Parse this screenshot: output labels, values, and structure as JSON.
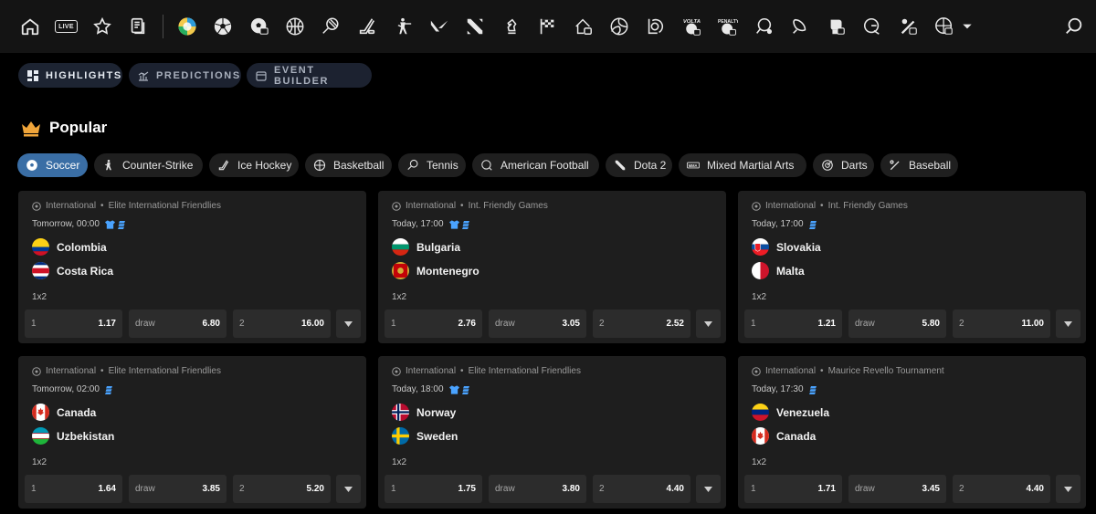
{
  "nav": {
    "live_label": "LIVE",
    "icons": [
      "home-icon",
      "live-icon",
      "star-icon",
      "betslip-icon",
      "all-sports-icon",
      "soccer-icon",
      "soccer-esports-icon",
      "basketball-icon",
      "tennis-icon",
      "hockey-icon",
      "counter-strike-icon",
      "valorant-icon",
      "dota-icon",
      "chess-icon",
      "racing-flag-icon",
      "virtual-icon",
      "volleyball-icon",
      "league-of-legends-icon",
      "volta-icon",
      "penalty-icon",
      "table-tennis-icon",
      "badminton-icon",
      "boxing-icon",
      "golf-icon",
      "baseball-icon",
      "cyber-basketball-icon",
      "more-chevron-icon",
      "search-icon"
    ]
  },
  "subtabs": [
    {
      "label": "HIGHLIGHTS",
      "active": true
    },
    {
      "label": "PREDICTIONS",
      "active": false
    },
    {
      "label": "EVENT BUILDER",
      "active": false
    }
  ],
  "popular": {
    "title": "Popular"
  },
  "sports": [
    {
      "label": "Soccer",
      "active": true
    },
    {
      "label": "Counter-Strike",
      "active": false
    },
    {
      "label": "Ice Hockey",
      "active": false
    },
    {
      "label": "Basketball",
      "active": false
    },
    {
      "label": "Tennis",
      "active": false
    },
    {
      "label": "American Football",
      "active": false
    },
    {
      "label": "Dota 2",
      "active": false
    },
    {
      "label": "Mixed Martial Arts",
      "active": false
    },
    {
      "label": "Darts",
      "active": false
    },
    {
      "label": "Baseball",
      "active": false
    }
  ],
  "matches": [
    {
      "region": "International",
      "league": "Elite International Friendlies",
      "time": "Tomorrow, 00:00",
      "home": "Colombia",
      "away": "Costa Rica",
      "market": "1x2",
      "odds": [
        {
          "label": "1",
          "value": "1.17"
        },
        {
          "label": "draw",
          "value": "6.80"
        },
        {
          "label": "2",
          "value": "16.00"
        }
      ]
    },
    {
      "region": "International",
      "league": "Int. Friendly Games",
      "time": "Today, 17:00",
      "home": "Bulgaria",
      "away": "Montenegro",
      "market": "1x2",
      "odds": [
        {
          "label": "1",
          "value": "2.76"
        },
        {
          "label": "draw",
          "value": "3.05"
        },
        {
          "label": "2",
          "value": "2.52"
        }
      ]
    },
    {
      "region": "International",
      "league": "Int. Friendly Games",
      "time": "Today, 17:00",
      "home": "Slovakia",
      "away": "Malta",
      "market": "1x2",
      "odds": [
        {
          "label": "1",
          "value": "1.21"
        },
        {
          "label": "draw",
          "value": "5.80"
        },
        {
          "label": "2",
          "value": "11.00"
        }
      ]
    },
    {
      "region": "International",
      "league": "Elite International Friendlies",
      "time": "Tomorrow, 02:00",
      "home": "Canada",
      "away": "Uzbekistan",
      "market": "1x2",
      "odds": [
        {
          "label": "1",
          "value": "1.64"
        },
        {
          "label": "draw",
          "value": "3.85"
        },
        {
          "label": "2",
          "value": "5.20"
        }
      ]
    },
    {
      "region": "International",
      "league": "Elite International Friendlies",
      "time": "Today, 18:00",
      "home": "Norway",
      "away": "Sweden",
      "market": "1x2",
      "odds": [
        {
          "label": "1",
          "value": "1.75"
        },
        {
          "label": "draw",
          "value": "3.80"
        },
        {
          "label": "2",
          "value": "4.40"
        }
      ]
    },
    {
      "region": "International",
      "league": "Maurice Revello Tournament",
      "time": "Today, 17:30",
      "home": "Venezuela",
      "away": "Canada",
      "market": "1x2",
      "odds": [
        {
          "label": "1",
          "value": "1.71"
        },
        {
          "label": "draw",
          "value": "3.45"
        },
        {
          "label": "2",
          "value": "4.40"
        }
      ]
    }
  ],
  "colors": {
    "accent": "#3a6ea5",
    "card_bg": "#1e1e1e",
    "odd_bg": "#2c2c2c",
    "crown": "#f0a53a",
    "jersey": "#4aa3ff"
  }
}
